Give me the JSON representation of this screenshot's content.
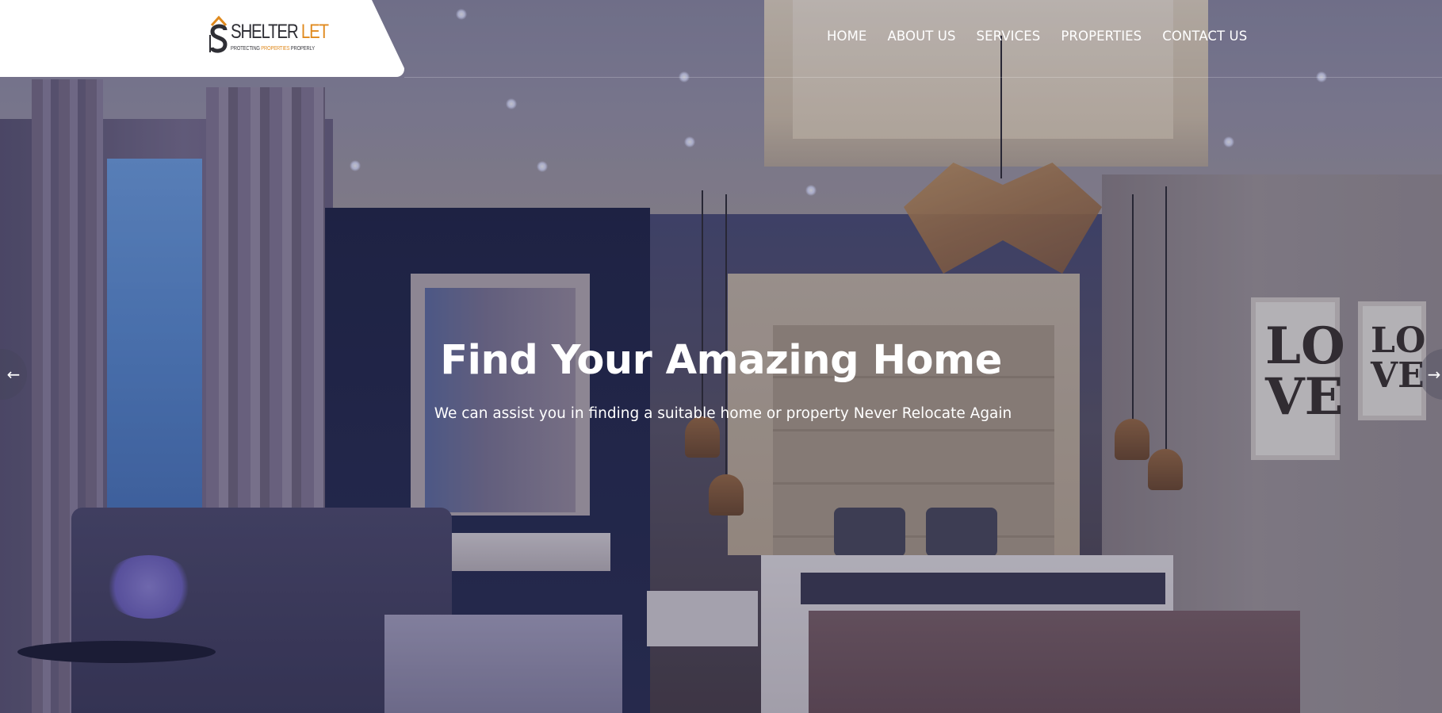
{
  "brand": {
    "name_part1": "SHELTER",
    "name_part2": "LET",
    "tagline_part1": "PROTECTING",
    "tagline_part2": "PROPERTIES",
    "tagline_part3": "PROPERLY",
    "accent_color": "#e08a1e",
    "dark_color": "#2f2f35"
  },
  "nav": {
    "items": [
      {
        "label": "HOME"
      },
      {
        "label": "ABOUT US"
      },
      {
        "label": "SERVICES"
      },
      {
        "label": "PROPERTIES"
      },
      {
        "label": "CONTACT US"
      }
    ]
  },
  "hero": {
    "title": "Find Your Amazing Home",
    "subtitle": "We can assist you in finding a suitable home or property Never Relocate Again",
    "prev_arrow": "←",
    "next_arrow": "→"
  }
}
